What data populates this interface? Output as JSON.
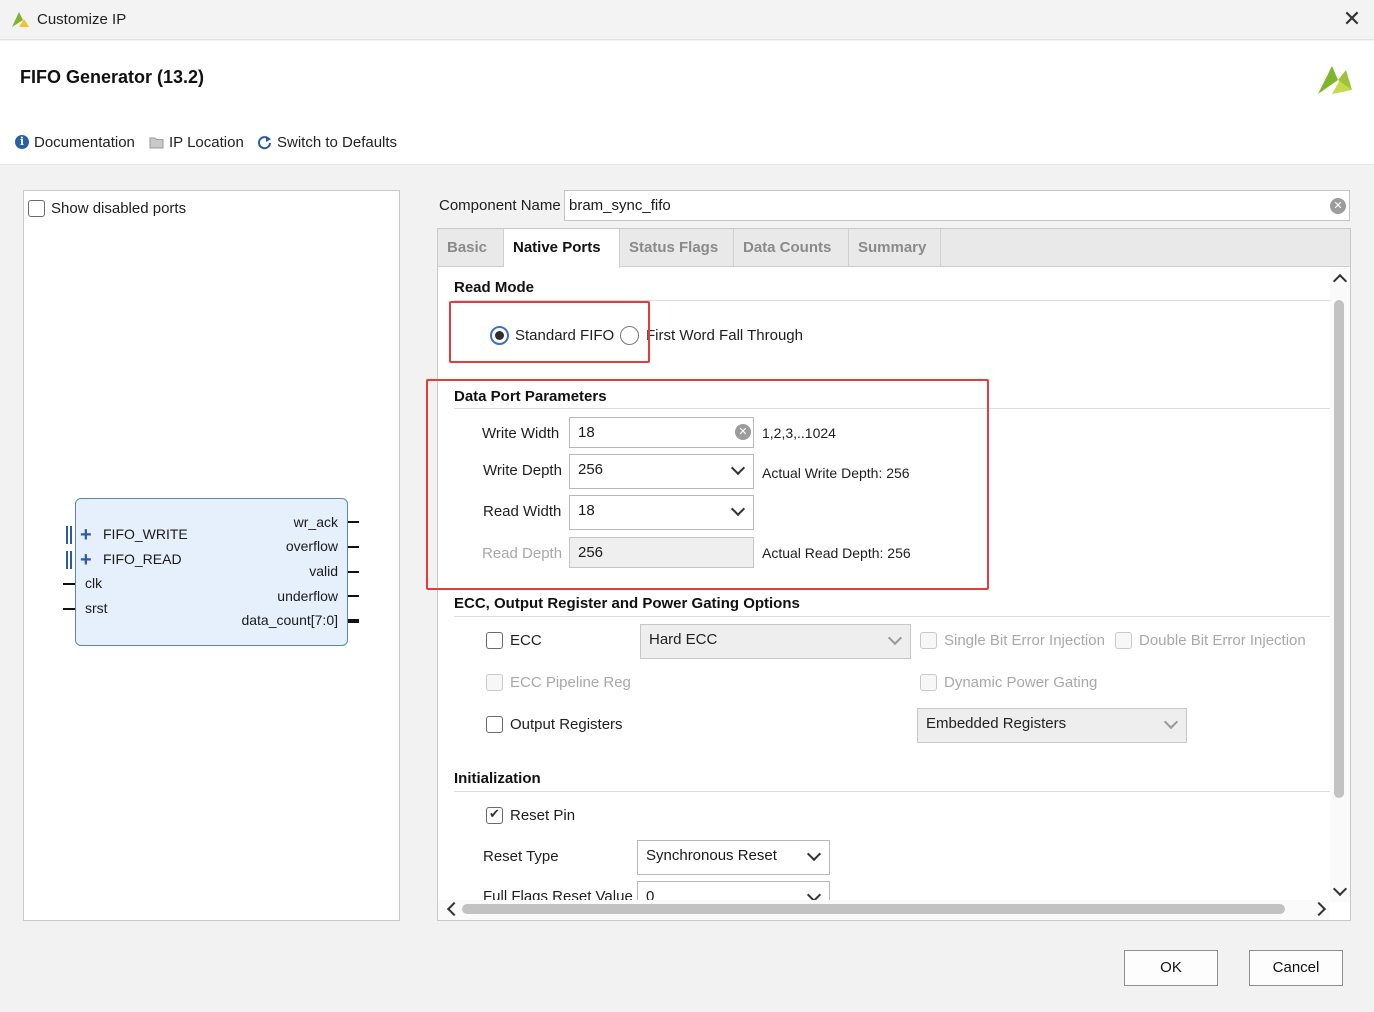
{
  "window": {
    "title": "Customize IP",
    "close_glyph": "✕"
  },
  "header": {
    "title": "FIFO Generator (13.2)"
  },
  "toolbar": {
    "documentation": "Documentation",
    "ip_location": "IP Location",
    "switch_to_defaults": "Switch to Defaults"
  },
  "left_panel": {
    "show_disabled_ports": "Show disabled ports",
    "ip_symbol": {
      "left_ports": [
        "FIFO_WRITE",
        "FIFO_READ",
        "clk",
        "srst"
      ],
      "right_ports": [
        "wr_ack",
        "overflow",
        "valid",
        "underflow",
        "data_count[7:0]"
      ]
    }
  },
  "component": {
    "label": "Component Name",
    "value": "bram_sync_fifo"
  },
  "tabs": [
    "Basic",
    "Native Ports",
    "Status Flags",
    "Data Counts",
    "Summary"
  ],
  "active_tab": "Native Ports",
  "read_mode": {
    "title": "Read Mode",
    "standard_fifo": "Standard FIFO",
    "fwft": "First Word Fall Through",
    "selected": "Standard FIFO"
  },
  "data_port": {
    "title": "Data Port Parameters",
    "write_width_label": "Write Width",
    "write_width_value": "18",
    "write_width_range": "1,2,3,..1024",
    "write_depth_label": "Write Depth",
    "write_depth_value": "256",
    "actual_write_depth": "Actual Write Depth: 256",
    "read_width_label": "Read Width",
    "read_width_value": "18",
    "read_depth_label": "Read Depth",
    "read_depth_value": "256",
    "actual_read_depth": "Actual Read Depth: 256"
  },
  "ecc": {
    "title": "ECC, Output Register and Power Gating Options",
    "ecc_label": "ECC",
    "ecc_type": "Hard ECC",
    "single_bit": "Single Bit Error Injection",
    "double_bit": "Double Bit Error Injection",
    "ecc_pipeline": "ECC Pipeline Reg",
    "dynamic_power": "Dynamic Power Gating",
    "output_registers": "Output Registers",
    "output_reg_type": "Embedded Registers"
  },
  "initialization": {
    "title": "Initialization",
    "reset_pin": "Reset Pin",
    "reset_pin_checked": true,
    "reset_type_label": "Reset Type",
    "reset_type_value": "Synchronous Reset",
    "full_flags_label": "Full Flags Reset Value",
    "full_flags_value": "0"
  },
  "buttons": {
    "ok": "OK",
    "cancel": "Cancel"
  },
  "colors": {
    "highlight": "#e63b3b",
    "accent": "#3c6fc7",
    "symbol_fill": "#e6f0fc"
  }
}
